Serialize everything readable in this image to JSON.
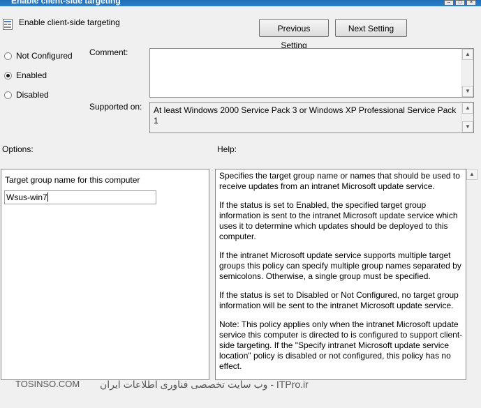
{
  "window": {
    "title": "Enable client-side targeting"
  },
  "header": {
    "policy_name": "Enable client-side targeting",
    "previous_label": "Previous Setting",
    "next_label": "Next Setting"
  },
  "state": {
    "options": [
      "Not Configured",
      "Enabled",
      "Disabled"
    ],
    "selected": "Enabled"
  },
  "comment": {
    "label": "Comment:",
    "value": ""
  },
  "supported": {
    "label": "Supported on:",
    "value": "At least Windows 2000 Service Pack 3 or Windows XP Professional Service Pack 1"
  },
  "options_section": {
    "label": "Options:",
    "field_label": "Target group name for this computer",
    "field_value": "Wsus-win7"
  },
  "help": {
    "label": "Help:",
    "paragraphs": [
      "Specifies the target group name or names that should be used to receive updates from an intranet Microsoft update service.",
      "If the status is set to Enabled, the specified target group information is sent to the intranet Microsoft update service which uses it to determine which updates should be deployed to this computer.",
      "If the intranet Microsoft update service supports multiple target groups this policy can specify multiple group names separated by semicolons. Otherwise, a single group must be specified.",
      "If the status is set to Disabled or Not Configured, no target group information will be sent to the intranet Microsoft update service.",
      "Note: This policy applies only when the intranet Microsoft update service this computer is directed to is configured to support client-side targeting. If the \"Specify intranet Microsoft update service location\" policy is disabled or not configured, this policy has no effect."
    ]
  },
  "watermarks": {
    "left": "TOSINSO.COM",
    "right": "ITPro.ir - وب سایت تخصصی فناوری اطلاعات ایران"
  }
}
